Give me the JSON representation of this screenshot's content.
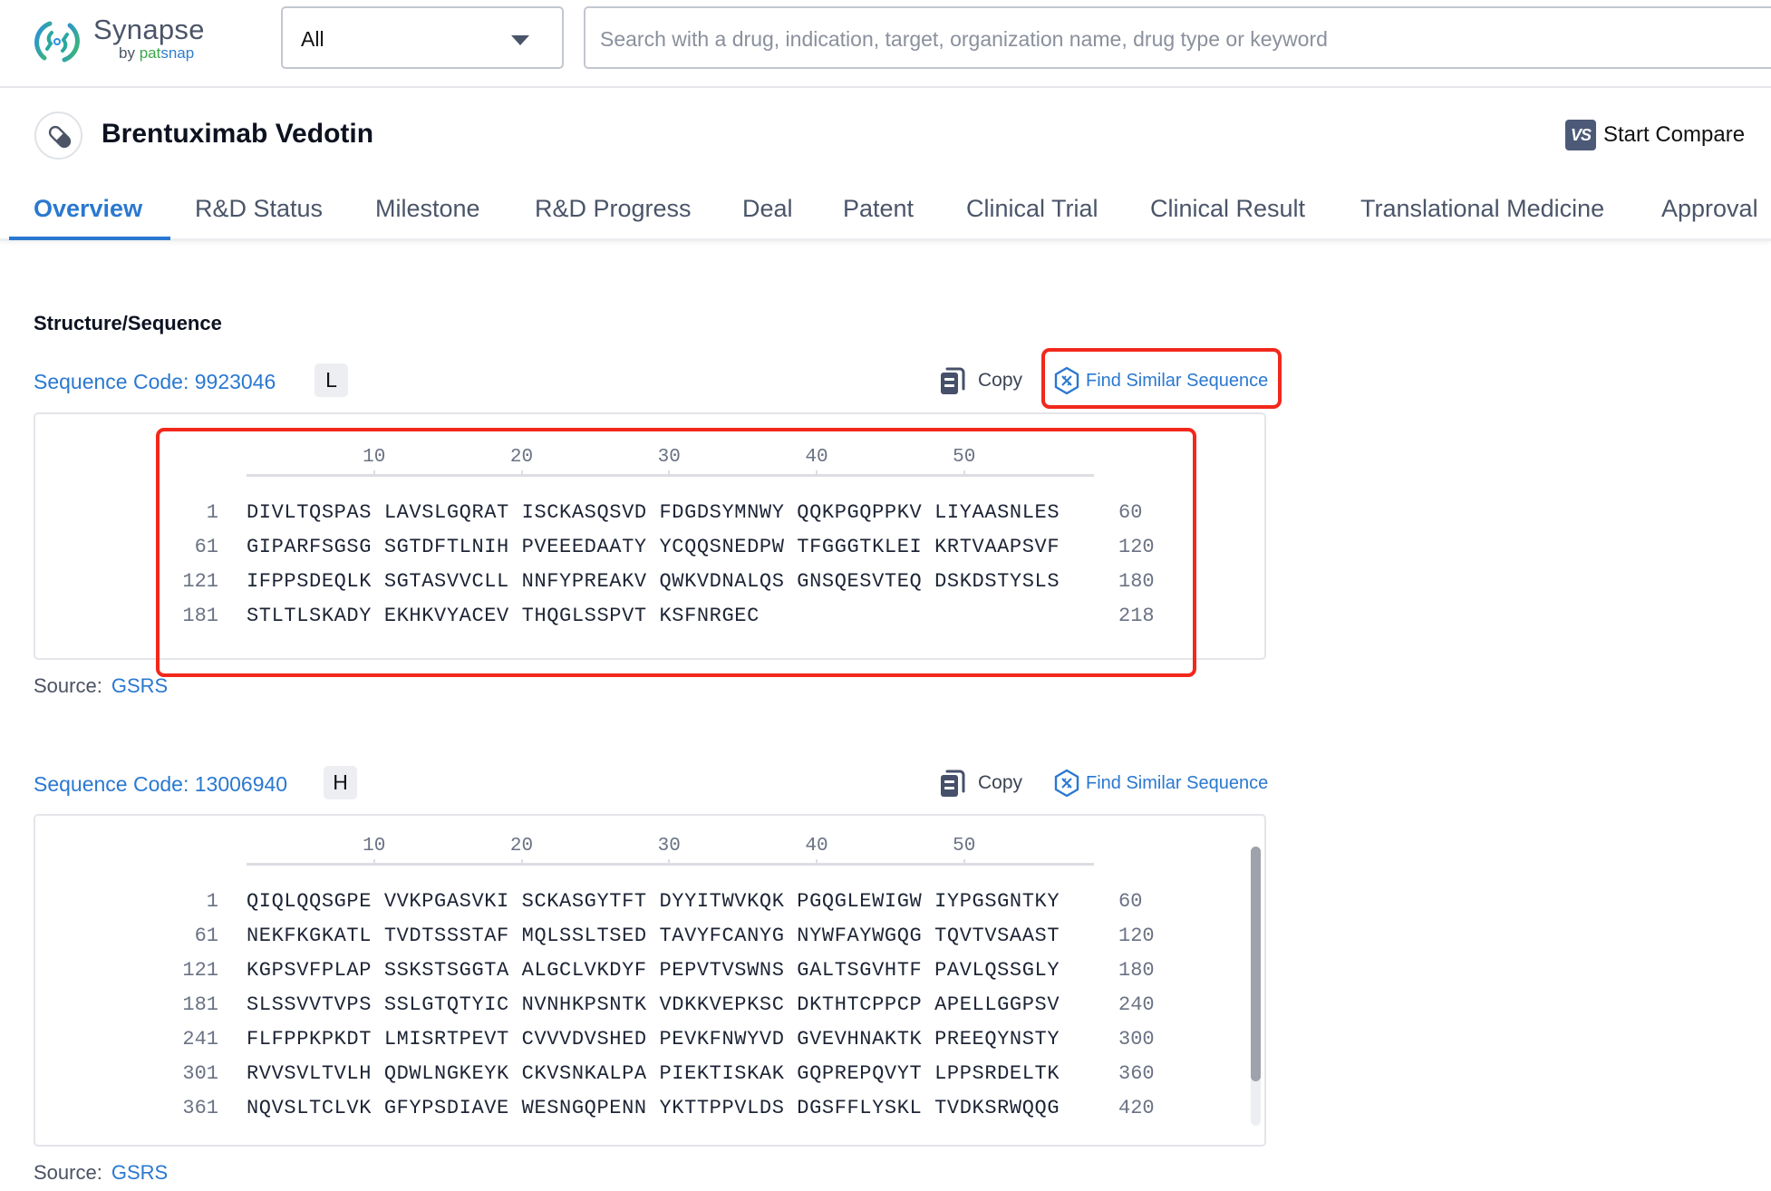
{
  "header": {
    "brand": "Synapse",
    "brand_by": "by",
    "brand_pat": "pat",
    "brand_snap": "snap",
    "scope_select_value": "All",
    "search_placeholder": "Search with a drug, indication, target, organization name, drug type or keyword",
    "search_value": ""
  },
  "drug": {
    "icon": "pill-icon",
    "title": "Brentuximab Vedotin",
    "compare_badge": "VS",
    "compare_label": "Start Compare"
  },
  "tabs": [
    {
      "label": "Overview",
      "active": true
    },
    {
      "label": "R&D Status",
      "active": false
    },
    {
      "label": "Milestone",
      "active": false
    },
    {
      "label": "R&D Progress",
      "active": false
    },
    {
      "label": "Deal",
      "active": false
    },
    {
      "label": "Patent",
      "active": false
    },
    {
      "label": "Clinical Trial",
      "active": false
    },
    {
      "label": "Clinical Result",
      "active": false
    },
    {
      "label": "Translational Medicine",
      "active": false
    },
    {
      "label": "Approval",
      "active": false
    }
  ],
  "section": {
    "title": "Structure/Sequence",
    "copy_label": "Copy",
    "similar_label": "Find Similar Sequence",
    "source_label": "Source:",
    "ruler_ticks": [
      "10",
      "20",
      "30",
      "40",
      "50"
    ]
  },
  "sequences": [
    {
      "code_label": "Sequence Code: 9923046",
      "chain": "L",
      "source": "GSRS",
      "rows": [
        {
          "start": "1",
          "residues": "DIVLTQSPAS LAVSLGQRAT ISCKASQSVD FDGDSYMNWY QQKPGQPPKV LIYAASNLES",
          "end": "60"
        },
        {
          "start": "61",
          "residues": "GIPARFSGSG SGTDFTLNIH PVEEEDAATY YCQQSNEDPW TFGGGTKLEI KRTVAAPSVF",
          "end": "120"
        },
        {
          "start": "121",
          "residues": "IFPPSDEQLK SGTASVVCLL NNFYPREAKV QWKVDNALQS GNSQESVTEQ DSKDSTYSLS",
          "end": "180"
        },
        {
          "start": "181",
          "residues": "STLTLSKADY EKHKVYACEV THQGLSSPVT KSFNRGEC",
          "end": "218"
        }
      ]
    },
    {
      "code_label": "Sequence Code: 13006940",
      "chain": "H",
      "source": "GSRS",
      "scroll_visible_fraction": 0.84,
      "rows": [
        {
          "start": "1",
          "residues": "QIQLQQSGPE VVKPGASVKI SCKASGYTFT DYYITWVKQK PGQGLEWIGW IYPGSGNTKY",
          "end": "60"
        },
        {
          "start": "61",
          "residues": "NEKFKGKATL TVDTSSSTAF MQLSSLTSED TAVYFCANYG NYWFAYWGQG TQVTVSAAST",
          "end": "120"
        },
        {
          "start": "121",
          "residues": "KGPSVFPLAP SSKSTSGGTA ALGCLVKDYF PEPVTVSWNS GALTSGVHTF PAVLQSSGLY",
          "end": "180"
        },
        {
          "start": "181",
          "residues": "SLSSVVTVPS SSLGTQTYIC NVNHKPSNTK VDKKVEPKSC DKTHTCPPCP APELLGGPSV",
          "end": "240"
        },
        {
          "start": "241",
          "residues": "FLFPPKPKDT LMISRTPEVT CVVVDVSHED PEVKFNWYVD GVEVHNAKTK PREEQYNSTY",
          "end": "300"
        },
        {
          "start": "301",
          "residues": "RVVSVLTVLH QDWLNGKEYK CKVSNKALPA PIEKTISKAK GQPREPQVYT LPPSRDELTK",
          "end": "360"
        },
        {
          "start": "361",
          "residues": "NQVSLTCLVK GFYPSDIAVE WESNGQPENN YKTTPPVLDS DGSFFLYSKL TVDKSRWQQG",
          "end": "420"
        }
      ]
    }
  ],
  "annotation_color": "#f2281c",
  "accent_color": "#2a78d0"
}
